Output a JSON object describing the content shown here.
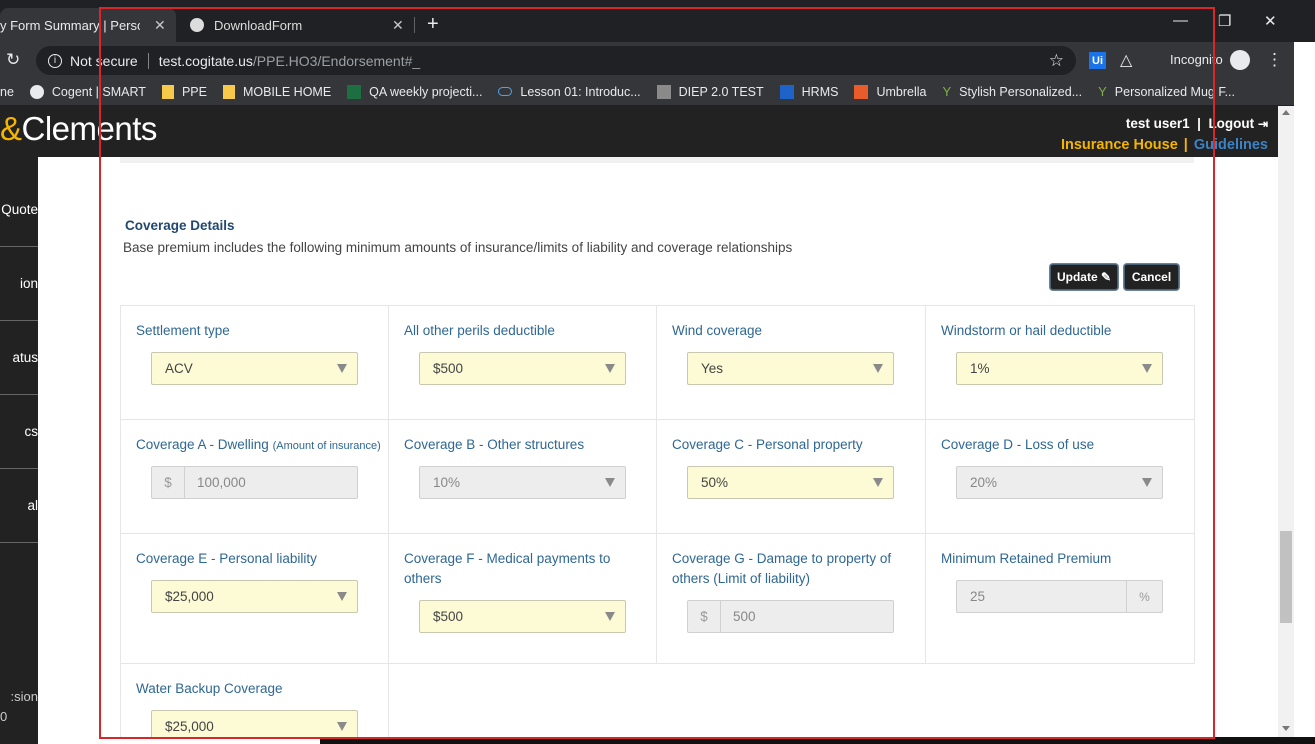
{
  "browser": {
    "tabs": [
      {
        "title": "y Form Summary | Personal Lines",
        "close": "✕"
      },
      {
        "title": "DownloadForm",
        "close": "✕"
      }
    ],
    "new_tab": "+",
    "window_controls": {
      "minimize": "—",
      "restore": "❐",
      "close": "✕"
    },
    "reload_icon": "↻",
    "security_label": "Not secure",
    "url_host": "test.cogitate.us",
    "url_path": "/PPE.HO3/Endorsement#_",
    "star_icon": "☆",
    "extension_label": "Ui",
    "incognito_label": "Incognito",
    "menu_icon": "⋮",
    "bookmarks": [
      {
        "label": "ne",
        "icon": "none"
      },
      {
        "label": "Cogent | SMART",
        "icon": "globe"
      },
      {
        "label": "PPE",
        "icon": "folder"
      },
      {
        "label": "MOBILE HOME",
        "icon": "folder"
      },
      {
        "label": "QA weekly projecti...",
        "icon": "excel"
      },
      {
        "label": "Lesson 01: Introduc...",
        "icon": "cloud"
      },
      {
        "label": "DIEP 2.0 TEST",
        "icon": "grey"
      },
      {
        "label": "HRMS",
        "icon": "blue"
      },
      {
        "label": "Umbrella",
        "icon": "umbrella"
      },
      {
        "label": "Stylish Personalized...",
        "icon": "leaf"
      },
      {
        "label": "Personalized Mug F...",
        "icon": "leaf"
      }
    ]
  },
  "header": {
    "logo_amp": "&",
    "logo_text": "Clements",
    "user": "test user1",
    "separator": "|",
    "logout": "Logout",
    "logout_icon": "⇥",
    "company": "Insurance House",
    "guidelines": "Guidelines"
  },
  "sidebar": {
    "items": [
      "Quote",
      "ion",
      "atus",
      "cs",
      "al"
    ],
    "version": "sion:",
    "version_num": "0"
  },
  "coverage": {
    "title": "Coverage Details",
    "description": "Base premium includes the following minimum amounts of insurance/limits of liability and coverage relationships",
    "update_label": "Update",
    "update_icon": "✎",
    "cancel_label": "Cancel",
    "fields": {
      "settlement_type": {
        "label": "Settlement type",
        "value": "ACV"
      },
      "all_other_perils": {
        "label": "All other perils deductible",
        "value": "$500"
      },
      "wind_coverage": {
        "label": "Wind coverage",
        "value": "Yes"
      },
      "windstorm_deductible": {
        "label": "Windstorm or hail deductible",
        "value": "1%"
      },
      "coverage_a": {
        "label": "Coverage A - Dwelling",
        "sublabel": "(Amount of insurance)",
        "prefix": "$",
        "value": "100,000"
      },
      "coverage_b": {
        "label": "Coverage B - Other structures",
        "value": "10%"
      },
      "coverage_c": {
        "label": "Coverage C - Personal property",
        "value": "50%"
      },
      "coverage_d": {
        "label": "Coverage D - Loss of use",
        "value": "20%"
      },
      "coverage_e": {
        "label": "Coverage E - Personal liability",
        "value": "$25,000"
      },
      "coverage_f": {
        "label": "Coverage F - Medical payments to others",
        "value": "$500"
      },
      "coverage_g": {
        "label": "Coverage G - Damage to property of others (Limit of liability)",
        "prefix": "$",
        "value": "500"
      },
      "min_retained_premium": {
        "label": "Minimum Retained Premium",
        "value": "25",
        "suffix": "%"
      },
      "water_backup": {
        "label": "Water Backup Coverage",
        "value": "$25,000"
      }
    }
  },
  "colors": {
    "header_bg": "#222222",
    "accent_yellow": "#f4b400",
    "link_blue": "#3b83c4",
    "label_blue": "#2e6793",
    "select_bg": "#fdfbd6",
    "highlight_red": "#d8262a"
  }
}
